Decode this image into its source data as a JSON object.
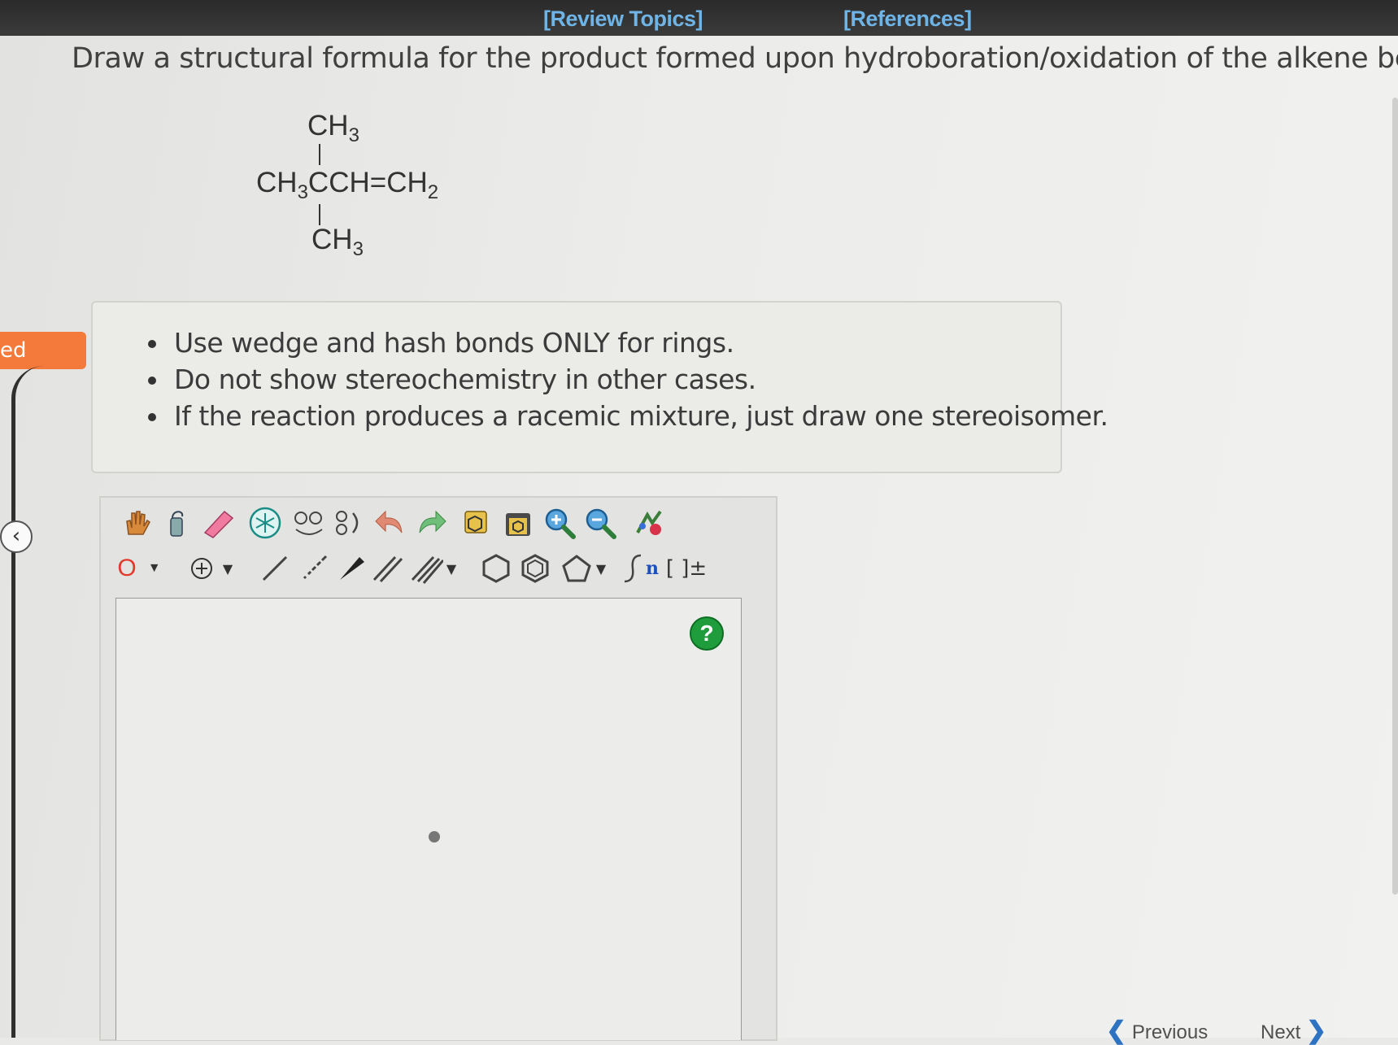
{
  "header": {
    "review_topics": "[Review Topics]",
    "references": "[References]"
  },
  "question": {
    "prompt": "Draw a structural formula for the product formed upon hydroboration/oxidation of the alkene below."
  },
  "molecule": {
    "top_group": "CH",
    "top_sub": "3",
    "main_a": "CH",
    "main_a_sub": "3",
    "main_b": "CCH=CH",
    "main_b_sub": "2",
    "bottom_group": "CH",
    "bottom_sub": "3"
  },
  "side_tab": {
    "label": "ed"
  },
  "instructions": {
    "items": [
      "Use wedge and hash bonds ONLY for rings.",
      "Do not show stereochemistry in other cases.",
      "If the reaction produces a racemic mixture, just draw one stereoisomer."
    ]
  },
  "editor": {
    "atom_selector": "O",
    "chain_label": "n",
    "bracket_label": "[ ]±",
    "help": "?"
  },
  "footer": {
    "previous": "Previous",
    "next": "Next"
  },
  "colors": {
    "accent_orange": "#f47a3c",
    "link_blue": "#6fb4e6",
    "help_green": "#1f9c3b"
  }
}
